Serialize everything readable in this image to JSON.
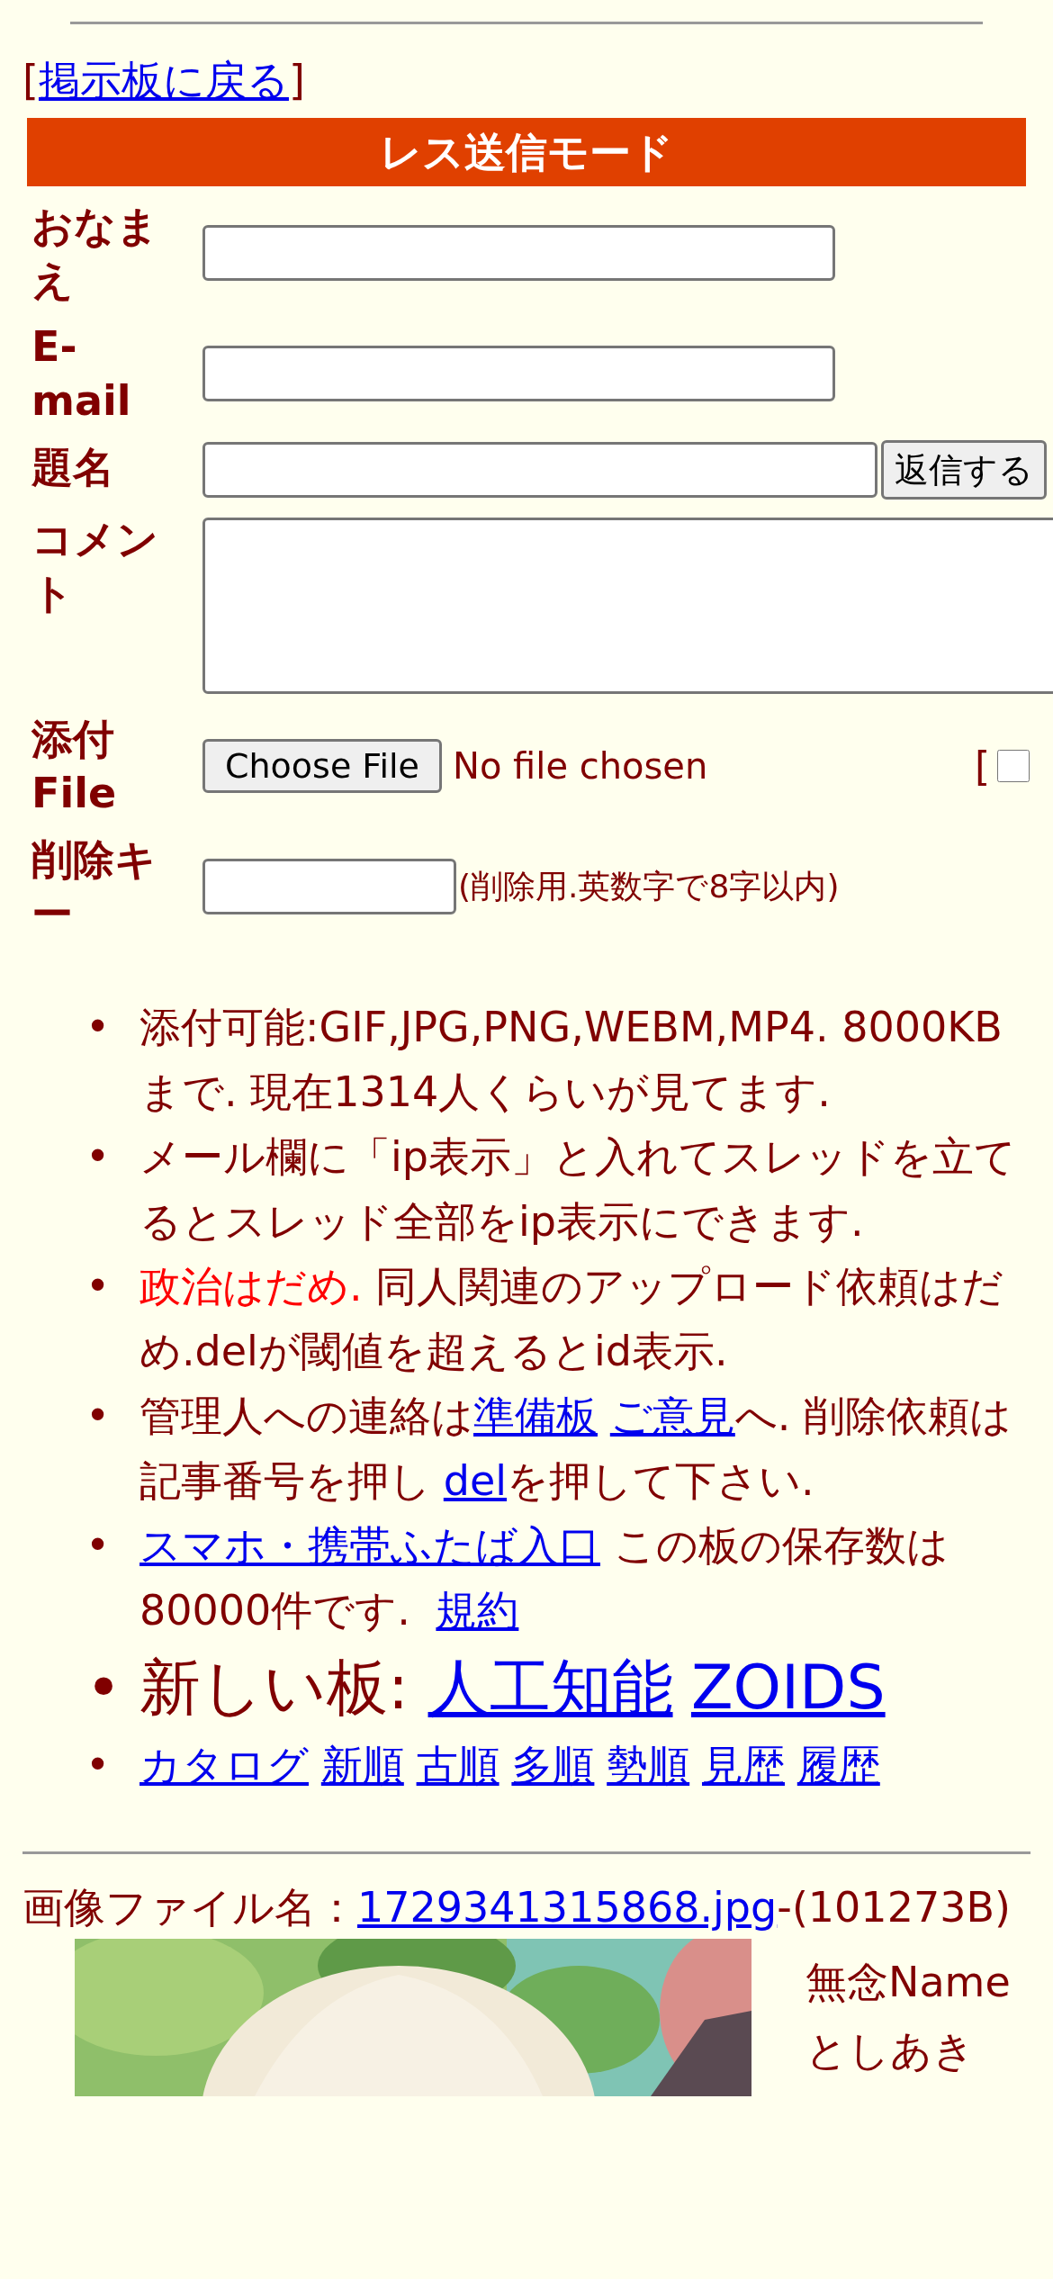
{
  "back_link": {
    "open": "[",
    "label": "掲示板に戻る",
    "close": "]"
  },
  "form": {
    "title": "レス送信モード",
    "fields": [
      {
        "kind": "text",
        "label": "おなまえ"
      },
      {
        "kind": "text",
        "label": "E-mail"
      },
      {
        "kind": "subject",
        "label": "題名",
        "button": "返信する"
      },
      {
        "kind": "textarea",
        "label": "コメント"
      },
      {
        "kind": "file",
        "label": "添付File",
        "button": "Choose File",
        "status": "No file chosen",
        "bracket": "[",
        "checked": false
      },
      {
        "kind": "password",
        "label": "削除キー",
        "hint": "(削除用.英数字で8字以内)"
      }
    ]
  },
  "notes": [
    {
      "kind": "normal",
      "marker": "•",
      "parts": [
        {
          "kind": "text",
          "text": "添付可能:GIF,JPG,PNG,WEBM,MP4. 8000KBまで. 現在1314人くらいが見てます."
        }
      ]
    },
    {
      "kind": "normal",
      "marker": "•",
      "parts": [
        {
          "kind": "text",
          "text": "メール欄に「ip表示」と入れてスレッドを立てるとスレッド全部をip表示にできます."
        }
      ]
    },
    {
      "kind": "normal",
      "marker": "•",
      "parts": [
        {
          "kind": "alert",
          "text": "政治はだめ."
        },
        {
          "kind": "text",
          "text": " 同人関連のアップロード依頼はだめ.delが閾値を超えるとid表示."
        }
      ]
    },
    {
      "kind": "normal",
      "marker": "•",
      "parts": [
        {
          "kind": "text",
          "text": "管理人への連絡は"
        },
        {
          "kind": "link",
          "text": "準備板"
        },
        {
          "kind": "link",
          "text": "ご意見"
        },
        {
          "kind": "text",
          "text": "へ. 削除依頼は記事番号を押し"
        },
        {
          "kind": "link",
          "text": "del"
        },
        {
          "kind": "text",
          "text": "を押して下さい."
        }
      ]
    },
    {
      "kind": "normal",
      "marker": "•",
      "parts": [
        {
          "kind": "link",
          "text": "スマホ・携帯ふたば入口"
        },
        {
          "kind": "text",
          "text": " この板の保存数は80000件です. "
        },
        {
          "kind": "link",
          "text": "規約"
        }
      ]
    },
    {
      "kind": "large",
      "marker": "•",
      "parts": [
        {
          "kind": "text",
          "text": "新しい板: "
        },
        {
          "kind": "link",
          "text": "人工知能"
        },
        {
          "kind": "link",
          "text": "ZOIDS"
        }
      ]
    },
    {
      "kind": "normal",
      "marker": "•",
      "parts": [
        {
          "kind": "link",
          "text": "カタログ"
        },
        {
          "kind": "link",
          "text": "新順"
        },
        {
          "kind": "link",
          "text": "古順"
        },
        {
          "kind": "link",
          "text": "多順"
        },
        {
          "kind": "link",
          "text": "勢順"
        },
        {
          "kind": "link",
          "text": "見歴"
        },
        {
          "kind": "link",
          "text": "履歴"
        }
      ]
    }
  ],
  "post": {
    "file_label": "画像ファイル名：",
    "file_link": "1729341315868.jpg",
    "file_size": "-(101273B)",
    "name": "無念Name",
    "author": "としあき"
  }
}
